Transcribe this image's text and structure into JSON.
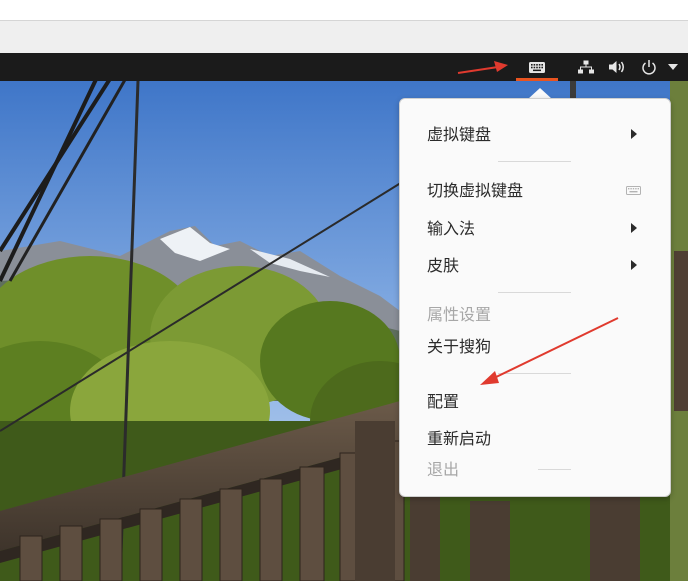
{
  "topbar": {
    "keyboard_icon": "keyboard-icon",
    "network_icon": "network-icon",
    "volume_icon": "volume-icon",
    "power_icon": "power-icon",
    "menu_arrow_icon": "chevron-down-icon",
    "accent_color": "#e95420"
  },
  "menu": {
    "items": [
      {
        "label": "虚拟键盘",
        "submenu": true
      },
      {
        "label": "切换虚拟键盘",
        "icon": "keyboard-icon"
      },
      {
        "label": "输入法",
        "submenu": true
      },
      {
        "label": "皮肤",
        "submenu": true
      },
      {
        "label": "属性设置",
        "disabled": true
      },
      {
        "label": "关于搜狗"
      },
      {
        "label": "配置"
      },
      {
        "label": "重新启动"
      },
      {
        "label": "退出",
        "disabled": true
      }
    ]
  },
  "annotations": {
    "arrow_color": "#e03a2e"
  }
}
